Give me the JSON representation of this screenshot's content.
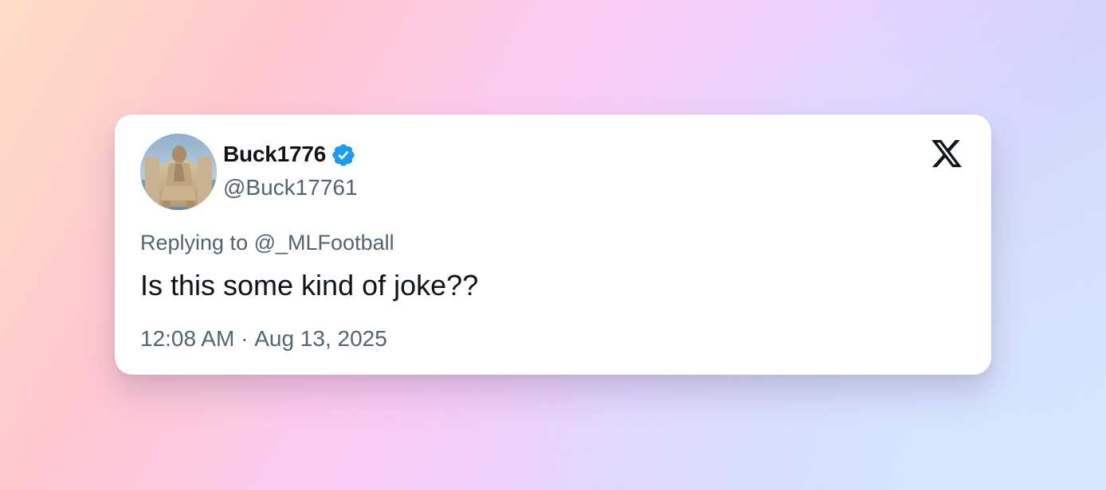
{
  "tweet": {
    "display_name": "Buck1776",
    "handle": "@Buck17761",
    "verified": true,
    "replying_prefix": "Replying to",
    "replying_to": "@_MLFootball",
    "text": "Is this some kind of joke??",
    "time": "12:08 AM",
    "separator": " · ",
    "date": "Aug 13, 2025"
  },
  "icons": {
    "avatar": "sand-sculpture-avatar",
    "verified": "verified-badge-icon",
    "brand": "x-logo-icon"
  },
  "colors": {
    "verified": "#1d9bf0",
    "text_primary": "#0f1419",
    "text_secondary": "#536471",
    "card": "#ffffff"
  }
}
